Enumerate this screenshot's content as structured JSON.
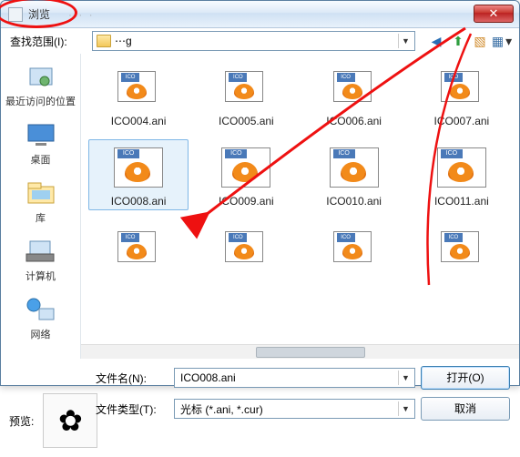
{
  "window": {
    "title": "浏览",
    "dimmed_text": "· · ·",
    "close": "✕"
  },
  "lookin": {
    "label": "查找范围(I):",
    "value": "⋯g"
  },
  "nav_icons": {
    "back": "back-icon",
    "up": "up-icon",
    "newfolder": "newfolder-icon",
    "view": "view-icon"
  },
  "sidebar": {
    "items": [
      {
        "label": "最近访问的位置"
      },
      {
        "label": "桌面"
      },
      {
        "label": "库"
      },
      {
        "label": "计算机"
      },
      {
        "label": "网络"
      }
    ]
  },
  "files": {
    "row1": [
      "ICO004.ani",
      "ICO005.ani",
      "ICO006.ani",
      "ICO007.ani"
    ],
    "row2": [
      "ICO008.ani",
      "ICO009.ani",
      "ICO010.ani",
      "ICO011.ani"
    ]
  },
  "filename": {
    "label": "文件名(N):",
    "value": "ICO008.ani"
  },
  "filetype": {
    "label": "文件类型(T):",
    "value": "光标 (*.ani, *.cur)"
  },
  "buttons": {
    "open": "打开(O)",
    "cancel": "取消"
  },
  "preview": {
    "label": "预览:"
  },
  "icon_tab": "ICO"
}
